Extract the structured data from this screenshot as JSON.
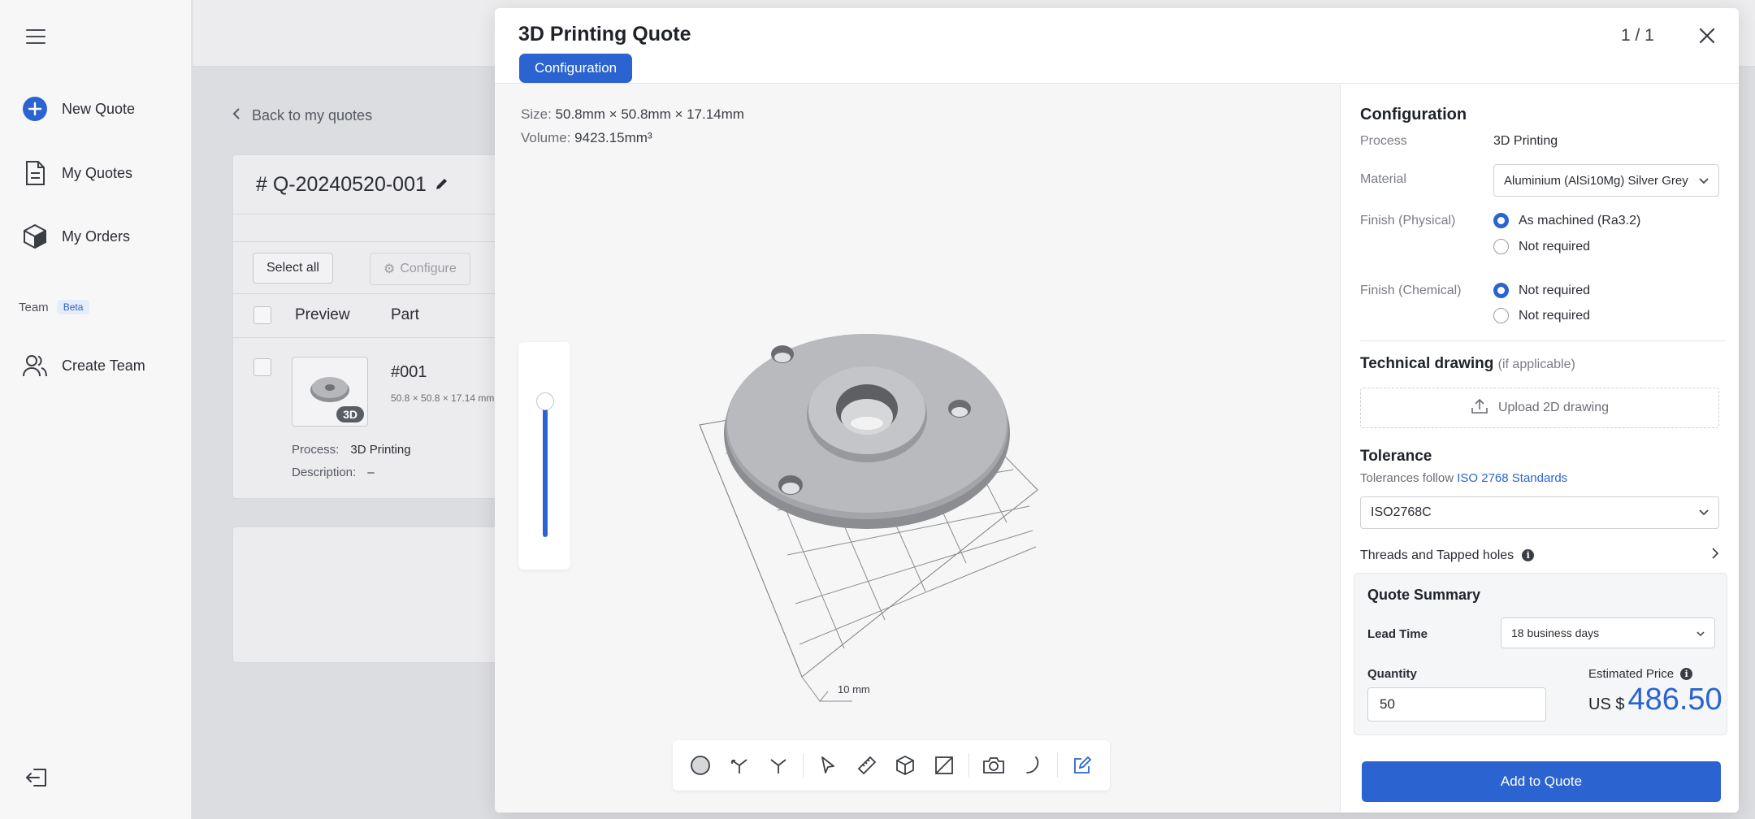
{
  "sidebar": {
    "items": [
      {
        "label": "New Quote",
        "icon": "plus-circle-icon"
      },
      {
        "label": "My Quotes",
        "icon": "document-icon"
      },
      {
        "label": "My Orders",
        "icon": "box-icon"
      }
    ],
    "team_label": "Team",
    "team_badge": "Beta",
    "create_team": "Create Team"
  },
  "background": {
    "back_link": "Back to my quotes",
    "quote_id": "# Q-20240520-001",
    "select_all": "Select all",
    "configure": "Configure",
    "columns": [
      "Preview",
      "Part"
    ],
    "part": {
      "badge": "3D",
      "number": "#001",
      "size": "50.8 × 50.8 × 17.14 mm",
      "process_label": "Process:",
      "process_value": "3D Printing",
      "description_label": "Description:",
      "description_value": "–"
    }
  },
  "modal": {
    "title": "3D Printing Quote",
    "tab": "Configuration",
    "pager": "1 / 1",
    "size_label": "Size:",
    "size_value": "50.8mm × 50.8mm × 17.14mm",
    "volume_label": "Volume:",
    "volume_value": "9423.15mm³",
    "scale_label": "10 mm"
  },
  "config": {
    "title": "Configuration",
    "process_label": "Process",
    "process_value": "3D Printing",
    "material_label": "Material",
    "material_value": "Aluminium (AlSi10Mg) Silver Grey",
    "finish_physical_label": "Finish (Physical)",
    "finish_physical_options": [
      "As machined (Ra3.2)",
      "Not required"
    ],
    "finish_physical_selected": 0,
    "finish_chemical_label": "Finish (Chemical)",
    "finish_chemical_options": [
      "Not required",
      "Not required"
    ],
    "finish_chemical_selected": 0,
    "tech_drawing_title": "Technical drawing",
    "tech_drawing_note": "(if applicable)",
    "upload_label": "Upload 2D drawing",
    "tolerance_title": "Tolerance",
    "tolerance_note": "Tolerances follow",
    "tolerance_link": "ISO 2768 Standards",
    "tolerance_value": "ISO2768C",
    "threads_label": "Threads and Tapped holes"
  },
  "summary": {
    "title": "Quote Summary",
    "lead_time_label": "Lead Time",
    "lead_time_value": "18 business days",
    "quantity_label": "Quantity",
    "quantity_value": "50",
    "price_label": "Estimated Price",
    "currency": "US $",
    "price": "486.50",
    "add_button": "Add to Quote"
  },
  "colors": {
    "accent": "#2b64d0"
  }
}
